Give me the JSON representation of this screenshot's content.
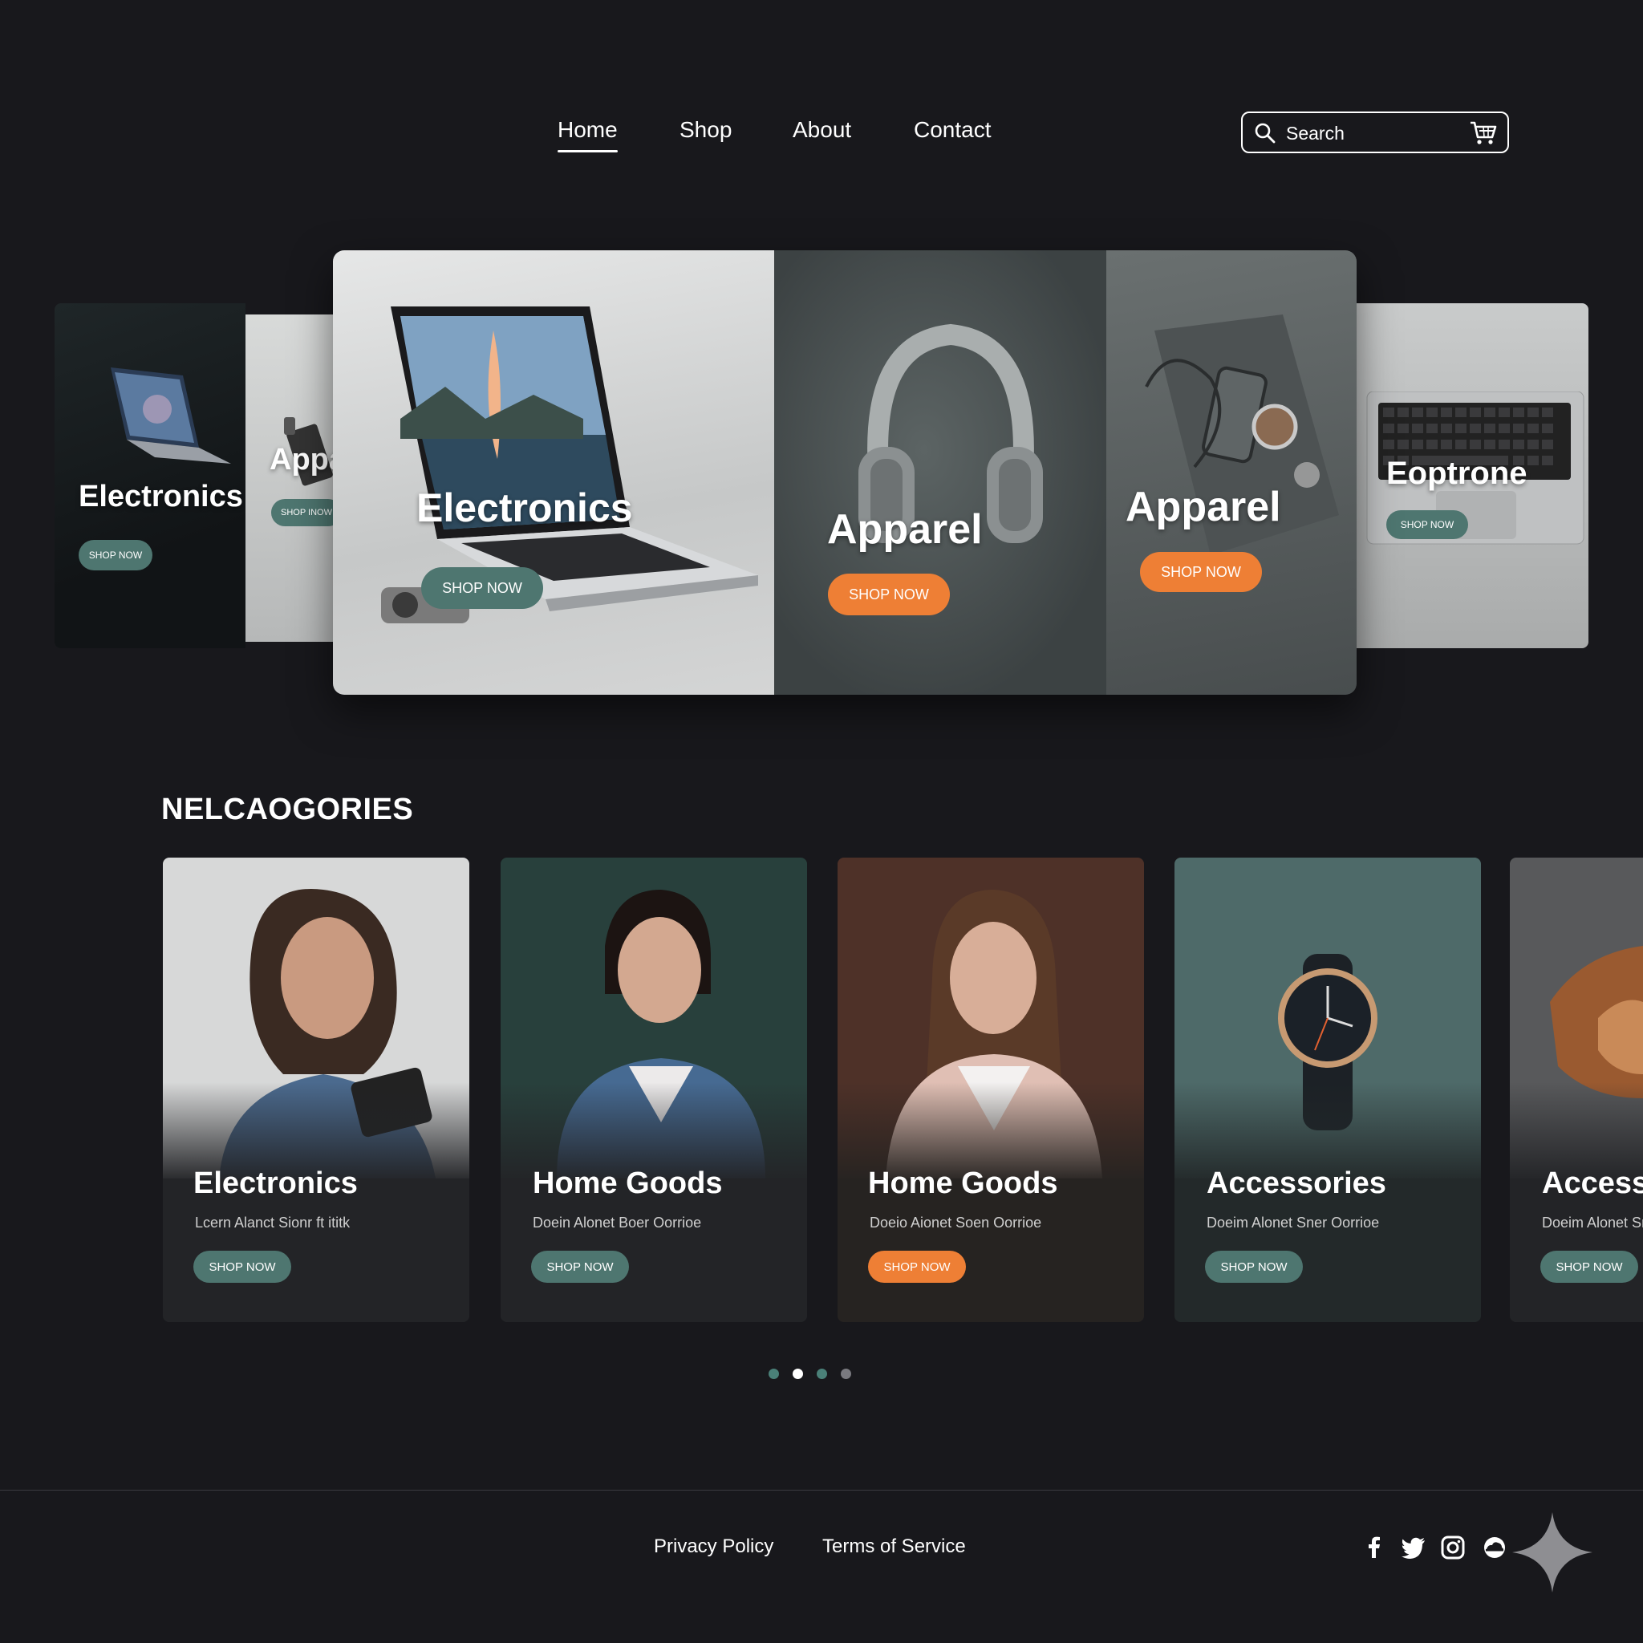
{
  "nav": {
    "links": [
      {
        "label": "Home",
        "active": true
      },
      {
        "label": "Shop"
      },
      {
        "label": "About"
      },
      {
        "label": "Contact"
      }
    ],
    "search_placeholder": "Search",
    "icons": {
      "search": "search-icon",
      "cart": "cart-icon"
    }
  },
  "hero": {
    "side_left": [
      {
        "title": "Electronics",
        "button": "SHOP NOW"
      },
      {
        "title": "Appa",
        "button": "SHOP INOW"
      }
    ],
    "main": [
      {
        "title": "Electronics",
        "button": "SHOP NOW",
        "button_color": "teal"
      },
      {
        "title": "Apparel",
        "button": "SHOP NOW",
        "button_color": "orange"
      },
      {
        "title": "Apparel",
        "button": "SHOP NOW",
        "button_color": "orange"
      }
    ],
    "side_right": {
      "title": "Eoptrone",
      "button": "SHOP NOW"
    }
  },
  "categories": {
    "title": "NELCAOGORIES",
    "cards": [
      {
        "title": "Electronics",
        "subtitle": "Lcern Alanct Sionr ft ititk",
        "button": "SHOP NOW",
        "button_color": "teal"
      },
      {
        "title": "Home Goods",
        "subtitle": "Doein Alonet Boer Oorrioe",
        "button": "SHOP NOW",
        "button_color": "teal"
      },
      {
        "title": "Home Goods",
        "subtitle": "Doeio Aionet Soen Oorrioe",
        "button": "SHOP NOW",
        "button_color": "orange"
      },
      {
        "title": "Accessories",
        "subtitle": "Doeim Alonet Sner Oorrioe",
        "button": "SHOP NOW",
        "button_color": "teal"
      },
      {
        "title": "Access",
        "subtitle": "Doeim Alonet Sr",
        "button": "SHOP NOW",
        "button_color": "teal"
      }
    ]
  },
  "pagination": {
    "count": 4,
    "active_index": 1
  },
  "footer": {
    "links": [
      "Privacy Policy",
      "Terms of Service"
    ],
    "social_icons": [
      "facebook-icon",
      "twitter-icon",
      "instagram-icon",
      "cloud-icon"
    ]
  },
  "colors": {
    "background": "#18181c",
    "teal": "#4e7670",
    "orange": "#ee7f35",
    "dot_teal": "#4a8078",
    "dot_active": "#ffffff",
    "dot_inactive": "#7a7a80"
  }
}
